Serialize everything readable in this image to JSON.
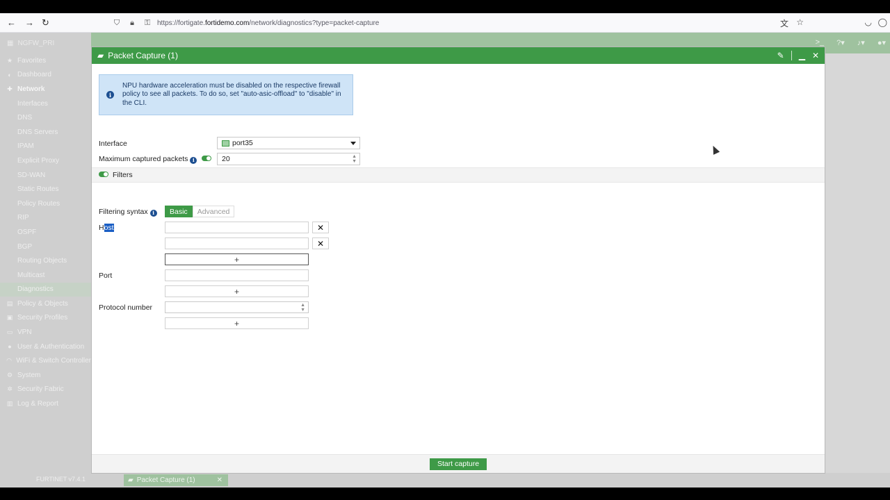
{
  "browser": {
    "url_prefix": "https://fortigate.",
    "url_host": "fortidemo.com",
    "url_path": "/network/diagnostics?type=packet-capture"
  },
  "app": {
    "device_name": "NGFW_PRI",
    "version": "v7.4.1",
    "brand": "FURTINET"
  },
  "sidebar": {
    "items": [
      {
        "label": "Favorites",
        "icon": "star-icon"
      },
      {
        "label": "Dashboard",
        "icon": "dashboard-icon"
      },
      {
        "label": "Network",
        "icon": "network-icon"
      },
      {
        "label": "Interfaces"
      },
      {
        "label": "DNS"
      },
      {
        "label": "DNS Servers"
      },
      {
        "label": "IPAM"
      },
      {
        "label": "Explicit Proxy"
      },
      {
        "label": "SD-WAN"
      },
      {
        "label": "Static Routes"
      },
      {
        "label": "Policy Routes"
      },
      {
        "label": "RIP"
      },
      {
        "label": "OSPF"
      },
      {
        "label": "BGP"
      },
      {
        "label": "Routing Objects"
      },
      {
        "label": "Multicast"
      },
      {
        "label": "Diagnostics"
      },
      {
        "label": "Policy & Objects",
        "icon": "policy-icon"
      },
      {
        "label": "Security Profiles",
        "icon": "lock-icon"
      },
      {
        "label": "VPN",
        "icon": "vpn-icon"
      },
      {
        "label": "User & Authentication",
        "icon": "user-icon"
      },
      {
        "label": "WiFi & Switch Controller",
        "icon": "wifi-icon"
      },
      {
        "label": "System",
        "icon": "gear-icon"
      },
      {
        "label": "Security Fabric",
        "icon": "fabric-icon"
      },
      {
        "label": "Log & Report",
        "icon": "chart-icon"
      }
    ]
  },
  "taskbar": {
    "task_label": "Packet Capture (1)"
  },
  "dialog": {
    "title": "Packet Capture (1)",
    "notice": "NPU hardware acceleration must be disabled on the respective firewall policy to see all packets. To do so, set \"auto-asic-offload\" to \"disable\" in the CLI.",
    "interface_label": "Interface",
    "interface_value": "port35",
    "max_packets_label": "Maximum captured packets",
    "max_packets_value": "20",
    "filters_label": "Filters",
    "filtering_syntax_label": "Filtering syntax",
    "syntax_basic": "Basic",
    "syntax_advanced": "Advanced",
    "host_label_first": "H",
    "host_label_rest": "ost",
    "port_label": "Port",
    "protocol_label": "Protocol number",
    "add_symbol": "+",
    "remove_symbol": "✕",
    "start_button": "Start capture"
  }
}
